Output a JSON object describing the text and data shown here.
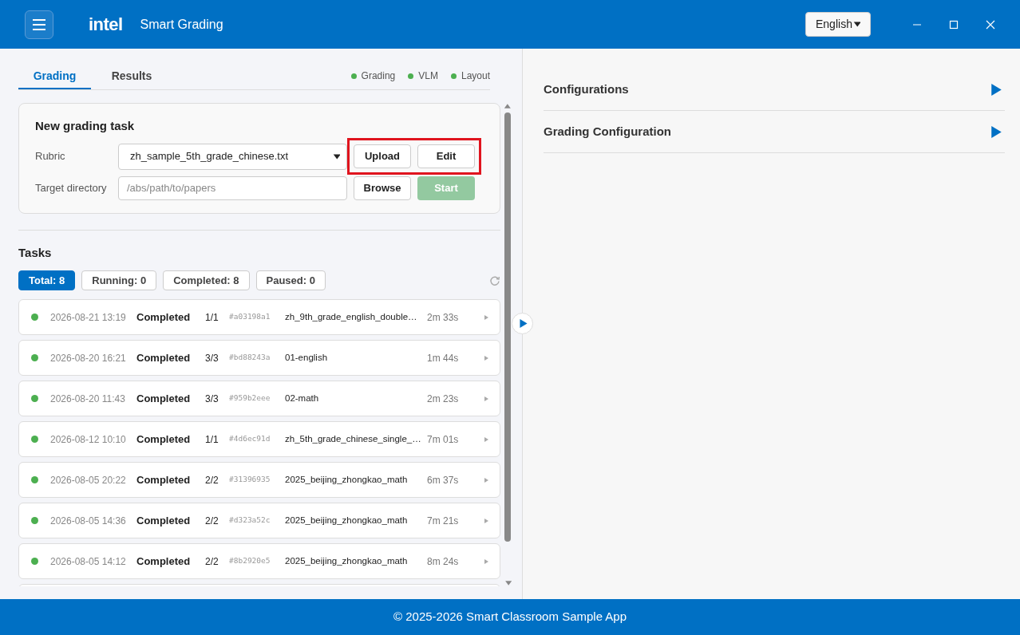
{
  "header": {
    "logo": "intel",
    "title": "Smart Grading",
    "language": "English"
  },
  "tabs": [
    {
      "label": "Grading",
      "selected": true
    },
    {
      "label": "Results",
      "selected": false
    }
  ],
  "services": [
    {
      "label": "Grading",
      "color": "#4caf50"
    },
    {
      "label": "VLM",
      "color": "#4caf50"
    },
    {
      "label": "Layout",
      "color": "#4caf50"
    }
  ],
  "new_task": {
    "title": "New grading task",
    "rubric_label": "Rubric",
    "rubric_value": "zh_sample_5th_grade_chinese.txt",
    "target_label": "Target directory",
    "target_placeholder": "/abs/path/to/papers",
    "upload": "Upload",
    "edit": "Edit",
    "browse": "Browse",
    "start": {
      "label": "Start",
      "disabled": true
    },
    "highlighted": true
  },
  "tasks": {
    "title": "Tasks",
    "filters": [
      {
        "label": "Total: 8",
        "selected": true
      },
      {
        "label": "Running: 0",
        "selected": false
      },
      {
        "label": "Completed: 8",
        "selected": false
      },
      {
        "label": "Paused: 0",
        "selected": false
      }
    ],
    "rows": [
      {
        "color": "#4caf50",
        "date": "2026-08-21 13:19",
        "status": "Completed",
        "progress": "1/1",
        "hash": "#a03198a1",
        "name": "zh_9th_grade_english_double…",
        "duration": "2m 33s"
      },
      {
        "color": "#4caf50",
        "date": "2026-08-20 16:21",
        "status": "Completed",
        "progress": "3/3",
        "hash": "#bd88243a",
        "name": "01-english",
        "duration": "1m 44s"
      },
      {
        "color": "#4caf50",
        "date": "2026-08-20 11:43",
        "status": "Completed",
        "progress": "3/3",
        "hash": "#959b2eee",
        "name": "02-math",
        "duration": "2m 23s"
      },
      {
        "color": "#4caf50",
        "date": "2026-08-12 10:10",
        "status": "Completed",
        "progress": "1/1",
        "hash": "#4d6ec91d",
        "name": "zh_5th_grade_chinese_single_…",
        "duration": "7m 01s"
      },
      {
        "color": "#4caf50",
        "date": "2026-08-05 20:22",
        "status": "Completed",
        "progress": "2/2",
        "hash": "#31396935",
        "name": "2025_beijing_zhongkao_math",
        "duration": "6m 37s"
      },
      {
        "color": "#4caf50",
        "date": "2026-08-05 14:36",
        "status": "Completed",
        "progress": "2/2",
        "hash": "#d323a52c",
        "name": "2025_beijing_zhongkao_math",
        "duration": "7m 21s"
      },
      {
        "color": "#4caf50",
        "date": "2026-08-05 14:12",
        "status": "Completed",
        "progress": "2/2",
        "hash": "#8b2920e5",
        "name": "2025_beijing_zhongkao_math",
        "duration": "8m 24s"
      }
    ]
  },
  "config_sections": [
    {
      "label": "Configurations",
      "expanded": false
    },
    {
      "label": "Grading Configuration",
      "expanded": false
    }
  ],
  "footer": "© 2025-2026 Smart Classroom Sample App"
}
